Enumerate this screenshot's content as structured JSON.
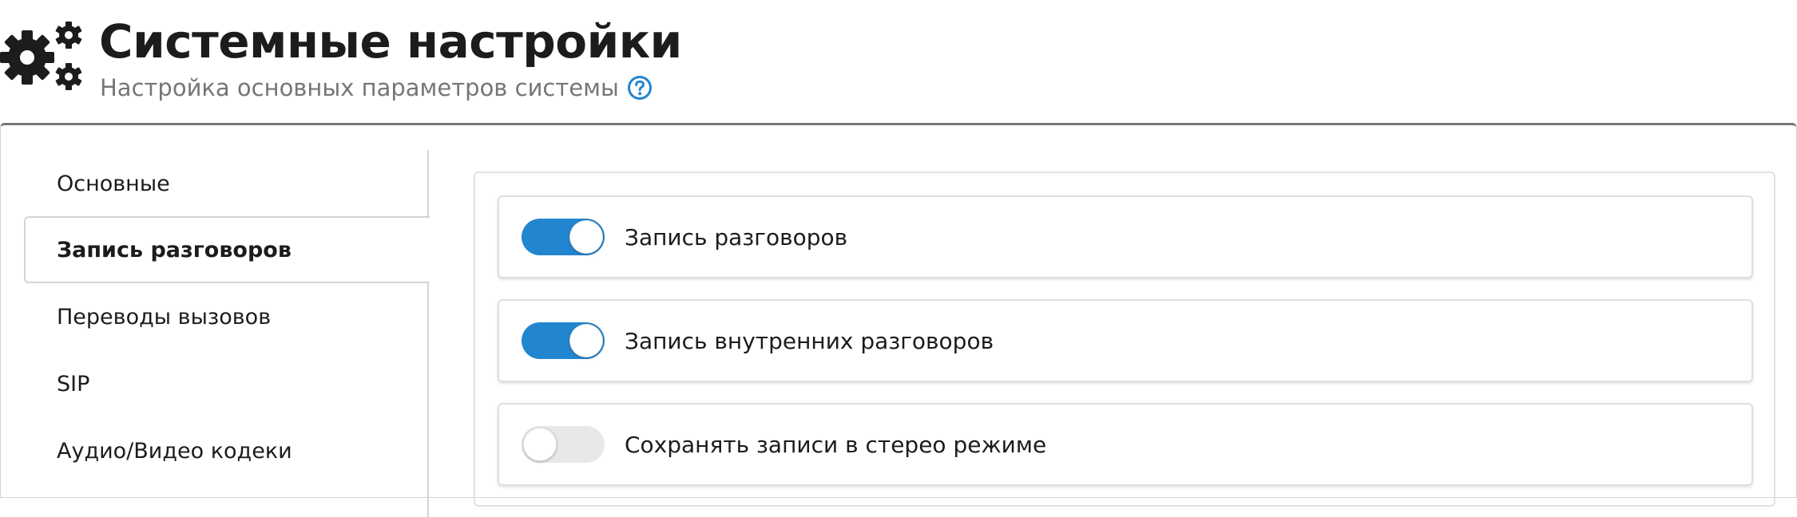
{
  "header": {
    "icon": "gears-icon",
    "title": "Системные настройки",
    "subtitle": "Настройка основных параметров системы",
    "help_icon": "question-circle-icon",
    "accent_color": "#2185d0"
  },
  "menu": {
    "items": [
      {
        "label": "Основные",
        "active": false
      },
      {
        "label": "Запись разговоров",
        "active": true
      },
      {
        "label": "Переводы вызовов",
        "active": false
      },
      {
        "label": "SIP",
        "active": false
      },
      {
        "label": "Аудио/Видео кодеки",
        "active": false
      }
    ]
  },
  "settings": [
    {
      "label": "Запись разговоров",
      "enabled": true
    },
    {
      "label": "Запись внутренних разговоров",
      "enabled": true
    },
    {
      "label": "Сохранять записи в стерео режиме",
      "enabled": false
    }
  ],
  "colors": {
    "toggle_on": "#2185d0",
    "toggle_off": "#e8e8e8",
    "title_text": "#1b1c1d",
    "muted_text": "#767676"
  }
}
